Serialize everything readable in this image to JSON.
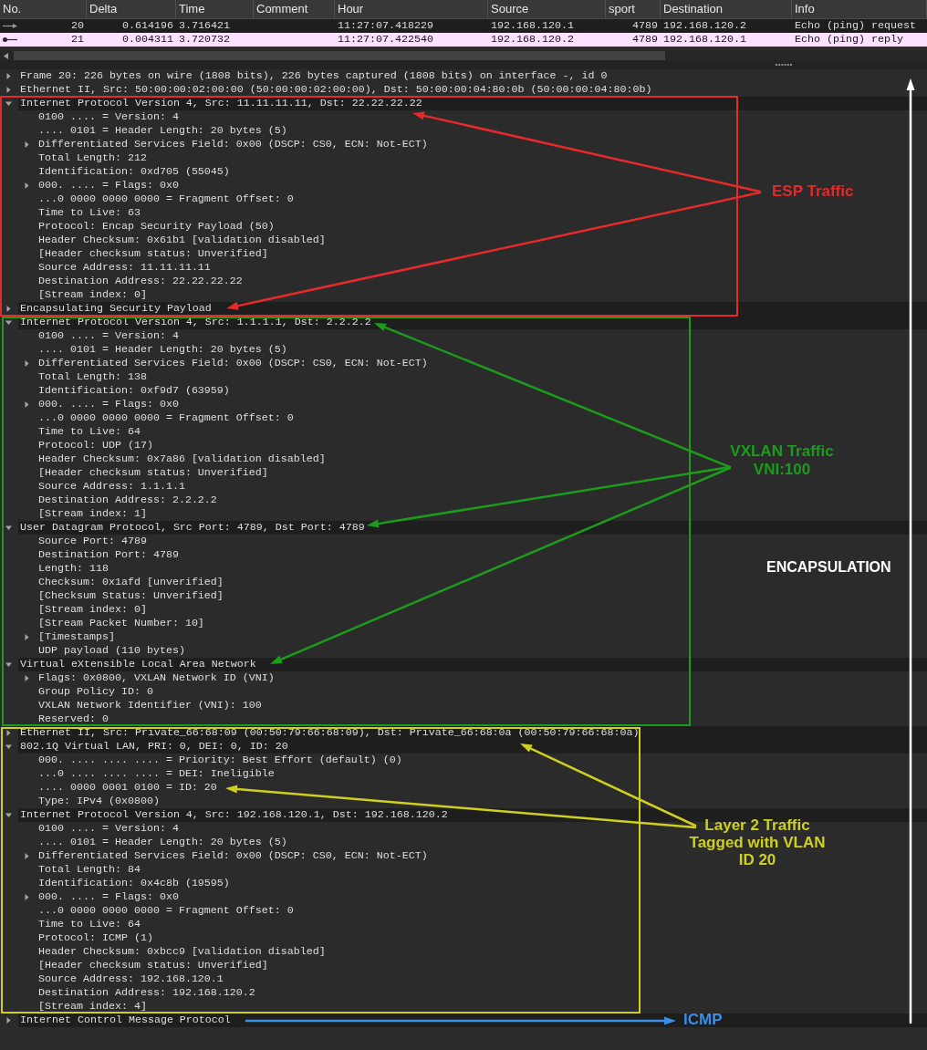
{
  "packet_list": {
    "columns": [
      "No.",
      "Delta",
      "Time",
      "Comment",
      "Hour",
      "Source",
      "sport",
      "Destination",
      "Info"
    ],
    "rows": [
      {
        "selected": true,
        "kind": "request",
        "no": "20",
        "delta": "0.614196",
        "time": "3.716421",
        "hour": "11:27:07.418229",
        "source": "192.168.120.1",
        "sport": "4789",
        "destination": "192.168.120.2",
        "info": "Echo (ping) request"
      },
      {
        "selected": false,
        "kind": "reply",
        "no": "21",
        "delta": "0.004311",
        "time": "3.720732",
        "hour": "11:27:07.422540",
        "source": "192.168.120.2",
        "sport": "4789",
        "destination": "192.168.120.1",
        "info": "Echo (ping) reply"
      }
    ]
  },
  "packet_details": {
    "tree": [
      {
        "text": "Frame 20: 226 bytes on wire (1808 bits), 226 bytes captured (1808 bits) on interface -, id 0",
        "expanded": false,
        "highlighted": false
      },
      {
        "text": "Ethernet II, Src: 50:00:00:02:00:00 (50:00:00:02:00:00), Dst: 50:00:00:04:80:0b (50:00:00:04:80:0b)",
        "expanded": false,
        "highlighted": false
      },
      {
        "text": "Internet Protocol Version 4, Src: 11.11.11.11, Dst: 22.22.22.22",
        "expanded": true,
        "highlighted": true,
        "children": [
          {
            "text": "0100 .... = Version: 4"
          },
          {
            "text": ".... 0101 = Header Length: 20 bytes (5)"
          },
          {
            "text": "Differentiated Services Field: 0x00 (DSCP: CS0, ECN: Not-ECT)",
            "expanded": false
          },
          {
            "text": "Total Length: 212"
          },
          {
            "text": "Identification: 0xd705 (55045)"
          },
          {
            "text": "000. .... = Flags: 0x0",
            "expanded": false
          },
          {
            "text": "...0 0000 0000 0000 = Fragment Offset: 0"
          },
          {
            "text": "Time to Live: 63"
          },
          {
            "text": "Protocol: Encap Security Payload (50)"
          },
          {
            "text": "Header Checksum: 0x61b1 [validation disabled]"
          },
          {
            "text": "[Header checksum status: Unverified]"
          },
          {
            "text": "Source Address: 11.11.11.11"
          },
          {
            "text": "Destination Address: 22.22.22.22"
          },
          {
            "text": "[Stream index: 0]"
          }
        ]
      },
      {
        "text": "Encapsulating Security Payload",
        "expanded": false,
        "highlighted": true
      },
      {
        "text": "Internet Protocol Version 4, Src: 1.1.1.1, Dst: 2.2.2.2",
        "expanded": true,
        "highlighted": true,
        "children": [
          {
            "text": "0100 .... = Version: 4"
          },
          {
            "text": ".... 0101 = Header Length: 20 bytes (5)"
          },
          {
            "text": "Differentiated Services Field: 0x00 (DSCP: CS0, ECN: Not-ECT)",
            "expanded": false
          },
          {
            "text": "Total Length: 138"
          },
          {
            "text": "Identification: 0xf9d7 (63959)"
          },
          {
            "text": "000. .... = Flags: 0x0",
            "expanded": false
          },
          {
            "text": "...0 0000 0000 0000 = Fragment Offset: 0"
          },
          {
            "text": "Time to Live: 64"
          },
          {
            "text": "Protocol: UDP (17)"
          },
          {
            "text": "Header Checksum: 0x7a86 [validation disabled]"
          },
          {
            "text": "[Header checksum status: Unverified]"
          },
          {
            "text": "Source Address: 1.1.1.1"
          },
          {
            "text": "Destination Address: 2.2.2.2"
          },
          {
            "text": "[Stream index: 1]"
          }
        ]
      },
      {
        "text": "User Datagram Protocol, Src Port: 4789, Dst Port: 4789",
        "expanded": true,
        "highlighted": true,
        "children": [
          {
            "text": "Source Port: 4789"
          },
          {
            "text": "Destination Port: 4789"
          },
          {
            "text": "Length: 118"
          },
          {
            "text": "Checksum: 0x1afd [unverified]"
          },
          {
            "text": "[Checksum Status: Unverified]"
          },
          {
            "text": "[Stream index: 0]"
          },
          {
            "text": "[Stream Packet Number: 10]"
          },
          {
            "text": "[Timestamps]",
            "expanded": false
          },
          {
            "text": "UDP payload (110 bytes)"
          }
        ]
      },
      {
        "text": "Virtual eXtensible Local Area Network",
        "expanded": true,
        "highlighted": true,
        "children": [
          {
            "text": "Flags: 0x0800, VXLAN Network ID (VNI)",
            "expanded": false
          },
          {
            "text": "Group Policy ID: 0"
          },
          {
            "text": "VXLAN Network Identifier (VNI): 100"
          },
          {
            "text": "Reserved: 0"
          }
        ]
      },
      {
        "text": "Ethernet II, Src: Private_66:68:09 (00:50:79:66:68:09), Dst: Private_66:68:0a (00:50:79:66:68:0a)",
        "expanded": false,
        "highlighted": true
      },
      {
        "text": "802.1Q Virtual LAN, PRI: 0, DEI: 0, ID: 20",
        "expanded": true,
        "highlighted": true,
        "children": [
          {
            "text": "000. .... .... .... = Priority: Best Effort (default) (0)"
          },
          {
            "text": "...0 .... .... .... = DEI: Ineligible"
          },
          {
            "text": ".... 0000 0001 0100 = ID: 20"
          },
          {
            "text": "Type: IPv4 (0x0800)"
          }
        ]
      },
      {
        "text": "Internet Protocol Version 4, Src: 192.168.120.1, Dst: 192.168.120.2",
        "expanded": true,
        "highlighted": true,
        "children": [
          {
            "text": "0100 .... = Version: 4"
          },
          {
            "text": ".... 0101 = Header Length: 20 bytes (5)"
          },
          {
            "text": "Differentiated Services Field: 0x00 (DSCP: CS0, ECN: Not-ECT)",
            "expanded": false
          },
          {
            "text": "Total Length: 84"
          },
          {
            "text": "Identification: 0x4c8b (19595)"
          },
          {
            "text": "000. .... = Flags: 0x0",
            "expanded": false
          },
          {
            "text": "...0 0000 0000 0000 = Fragment Offset: 0"
          },
          {
            "text": "Time to Live: 64"
          },
          {
            "text": "Protocol: ICMP (1)"
          },
          {
            "text": "Header Checksum: 0xbcc9 [validation disabled]"
          },
          {
            "text": "[Header checksum status: Unverified]"
          },
          {
            "text": "Source Address: 192.168.120.1"
          },
          {
            "text": "Destination Address: 192.168.120.2"
          },
          {
            "text": "[Stream index: 4]"
          }
        ]
      },
      {
        "text": "Internet Control Message Protocol",
        "expanded": false,
        "highlighted": true
      }
    ]
  },
  "annotations": [
    {
      "text": "ESP Traffic",
      "color": "#e42a2a"
    },
    {
      "text": "VXLAN Traffic VNI:100",
      "color": "#1d9b1d"
    },
    {
      "text": "Layer 2 Traffic Tagged with VLAN ID 20",
      "color": "#cfcf1f"
    },
    {
      "text": "ICMP",
      "color": "#3b8ee8"
    },
    {
      "text": "ENCAPSULATION",
      "color": "#ffffff"
    }
  ]
}
